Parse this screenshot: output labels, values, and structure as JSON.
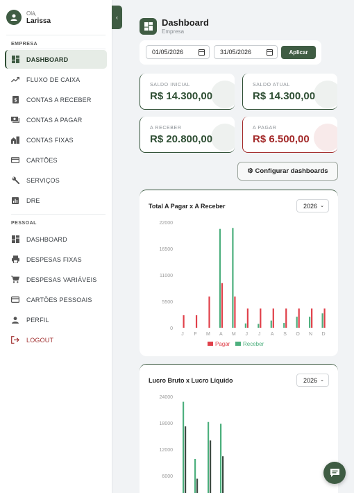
{
  "user": {
    "greeting": "Olá,",
    "name": "Larissa"
  },
  "sidebar": {
    "sections": [
      {
        "label": "EMPRESA",
        "items": [
          {
            "label": "DASHBOARD",
            "icon": "dashboard-icon",
            "active": true
          },
          {
            "label": "FLUXO DE CAIXA",
            "icon": "trending-up-icon"
          },
          {
            "label": "CONTAS A RECEBER",
            "icon": "receipt-icon"
          },
          {
            "label": "CONTAS A PAGAR",
            "icon": "money-icon"
          },
          {
            "label": "CONTAS FIXAS",
            "icon": "buildings-icon"
          },
          {
            "label": "CARTÕES",
            "icon": "credit-card-icon"
          },
          {
            "label": "SERVIÇOS",
            "icon": "wrench-icon"
          },
          {
            "label": "DRE",
            "icon": "bar-chart-icon"
          }
        ]
      },
      {
        "label": "PESSOAL",
        "items": [
          {
            "label": "DASHBOARD",
            "icon": "dashboard-icon"
          },
          {
            "label": "DESPESAS FIXAS",
            "icon": "printer-icon"
          },
          {
            "label": "DESPESAS VARIÁVEIS",
            "icon": "cart-icon"
          },
          {
            "label": "CARTÕES PESSOAIS",
            "icon": "credit-card-icon"
          },
          {
            "label": "PERFIL",
            "icon": "person-icon"
          },
          {
            "label": "LOGOUT",
            "icon": "logout-icon",
            "danger": true
          }
        ]
      }
    ]
  },
  "header": {
    "title": "Dashboard",
    "subtitle": "Empresa"
  },
  "filters": {
    "start_date": "01/05/2026",
    "end_date": "31/05/2026",
    "apply_label": "Aplicar"
  },
  "cards": {
    "saldo_inicial": {
      "label": "SALDO INICIAL",
      "value": "R$ 14.300,00"
    },
    "saldo_atual": {
      "label": "SALDO ATUAL",
      "value": "R$ 14.300,00"
    },
    "a_receber": {
      "label": "A RECEBER",
      "value": "R$ 20.800,00"
    },
    "a_pagar": {
      "label": "A PAGAR",
      "value": "R$ 6.500,00"
    }
  },
  "config_button": "⚙ Configurar dashboards",
  "colors": {
    "accent": "#3f5c43",
    "pagar": "#e0404a",
    "receber": "#4caf7d",
    "bruto": "#4caf7d",
    "liquido": "#3d4a42",
    "danger": "#a32a2a"
  },
  "chart_data": [
    {
      "type": "bar",
      "title": "Total A Pagar x A Receber",
      "year": "2026",
      "categories": [
        "J",
        "F",
        "M",
        "A",
        "M",
        "J",
        "J",
        "A",
        "S",
        "O",
        "N",
        "D"
      ],
      "yticks": [
        "0",
        "5500",
        "11000",
        "16500",
        "22000"
      ],
      "ylim": [
        0,
        22000
      ],
      "series": [
        {
          "name": "Pagar",
          "color": "#e0404a",
          "values": [
            2600,
            2600,
            6500,
            9300,
            6500,
            4000,
            4000,
            4000,
            4000,
            4000,
            4000,
            4000
          ]
        },
        {
          "name": "Receber",
          "color": "#4caf7d",
          "values": [
            0,
            0,
            0,
            20600,
            20800,
            900,
            800,
            1500,
            1000,
            2300,
            2300,
            3000
          ]
        }
      ],
      "legend": "bottom"
    },
    {
      "type": "bar",
      "title": "Lucro Bruto x Lucro Líquido",
      "year": "2026",
      "yticks": [
        "6000",
        "12000",
        "18000",
        "24000"
      ],
      "ylim": [
        0,
        24000
      ],
      "series": [
        {
          "values": [
            22800,
            9800,
            18200,
            17800
          ]
        },
        {
          "values": [
            17200,
            5300,
            14000,
            10400
          ]
        }
      ]
    }
  ]
}
